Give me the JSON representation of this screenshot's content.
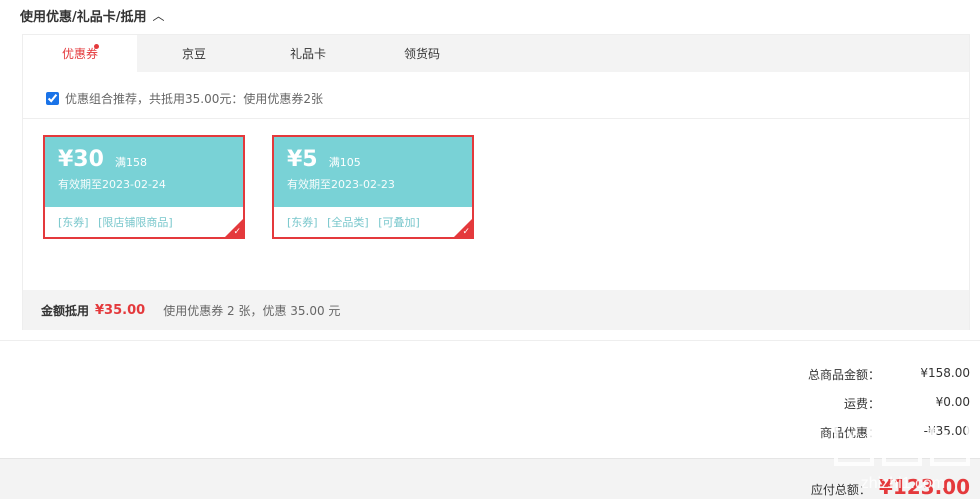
{
  "section": {
    "title": "使用优惠/礼品卡/抵用",
    "toggle_icon": "chevron-up-icon"
  },
  "tabs": [
    {
      "label": "优惠券",
      "active": true,
      "has_dot": true
    },
    {
      "label": "京豆",
      "active": false
    },
    {
      "label": "礼品卡",
      "active": false
    },
    {
      "label": "领货码",
      "active": false
    }
  ],
  "combo": {
    "checked": true,
    "text": "优惠组合推荐，共抵用35.00元：使用优惠券2张"
  },
  "coupons": [
    {
      "amount": "¥30",
      "condition": "满158",
      "expiry": "有效期至2023-02-24",
      "tags": [
        "[东券]",
        "[限店铺限商品]"
      ],
      "selected": true
    },
    {
      "amount": "¥5",
      "condition": "满105",
      "expiry": "有效期至2023-02-23",
      "tags": [
        "[东券]",
        "[全品类]",
        "[可叠加]"
      ],
      "selected": true
    }
  ],
  "summary": {
    "label": "金额抵用",
    "value": "¥35.00",
    "text": "使用优惠券 2 张，优惠 35.00 元"
  },
  "totals": [
    {
      "label": "总商品金额：",
      "value": "¥158.00"
    },
    {
      "label": "运费：",
      "value": "¥0.00"
    },
    {
      "label": "商品优惠：",
      "value": "-¥35.00"
    }
  ],
  "footer": {
    "label": "应付总额：",
    "value": "¥123.00"
  },
  "colors": {
    "accent": "#e4393c",
    "coupon_bg": "#79d2d6",
    "panel_bg": "#f3f3f3"
  },
  "watermark": "zhizhi1.com"
}
